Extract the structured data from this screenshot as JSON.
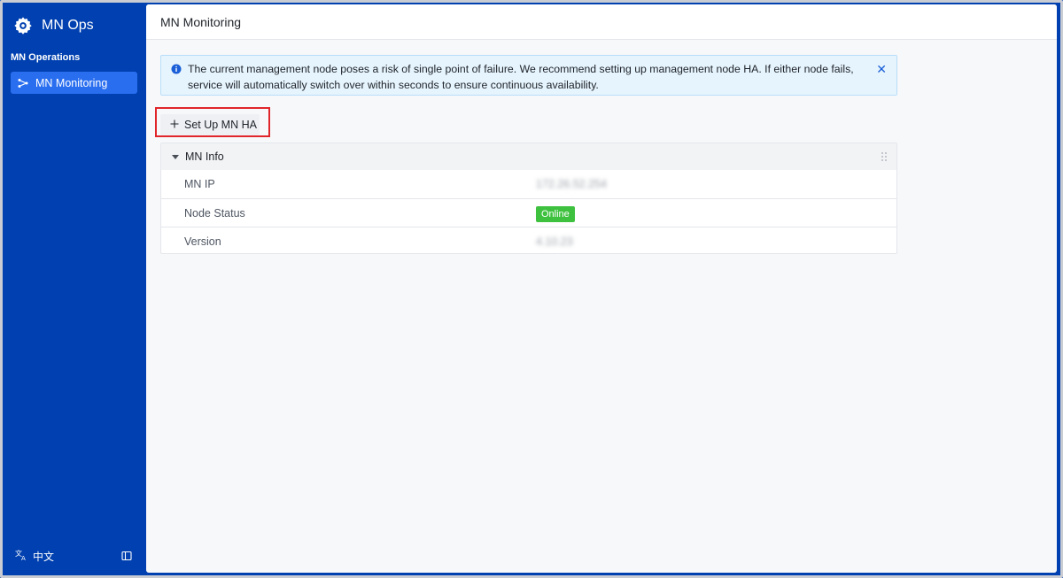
{
  "app": {
    "name": "MN Ops",
    "brand_icon": "gear-settings-icon"
  },
  "sidebar": {
    "section_label": "MN Operations",
    "items": [
      {
        "label": "MN Monitoring",
        "icon": "topology-icon",
        "active": true
      }
    ],
    "footer": {
      "language_label": "中文",
      "language_icon": "translate-icon",
      "collapse_icon": "sidebar-collapse-icon"
    }
  },
  "header": {
    "title": "MN Monitoring"
  },
  "alert": {
    "text": "The current management node poses a risk of single point of failure. We recommend setting up management node HA. If either node fails, service will automatically switch over within seconds to ensure continuous availability.",
    "icon": "info-icon",
    "close_icon": "close-icon"
  },
  "actions": {
    "setup_ha_label": "Set Up MN HA"
  },
  "mn_info": {
    "title": "MN Info",
    "rows": [
      {
        "label": "MN IP",
        "value": "172.26.52.254"
      },
      {
        "label": "Node Status",
        "value": "Online"
      },
      {
        "label": "Version",
        "value": "4.10.23"
      }
    ]
  },
  "colors": {
    "sidebar_bg": "#0040b0",
    "active_item_bg": "#2a6ef0",
    "status_online": "#3fc140",
    "highlight_border": "#e0252b",
    "alert_bg": "#e6f4fd"
  }
}
